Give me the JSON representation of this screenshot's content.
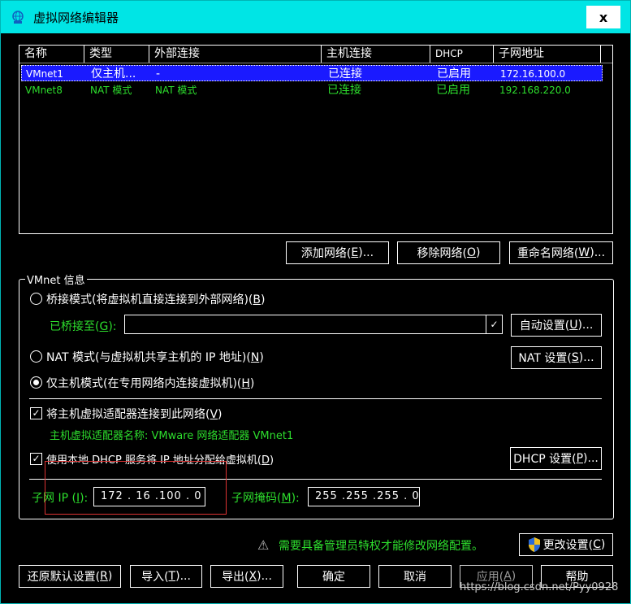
{
  "window": {
    "title": "虚拟网络编辑器",
    "close": "x"
  },
  "table": {
    "columns": [
      "名称",
      "类型",
      "外部连接",
      "主机连接",
      "DHCP",
      "子网地址"
    ],
    "rows": [
      {
        "name": "VMnet1",
        "type": "仅主机...",
        "external": "-",
        "host": "已连接",
        "dhcp": "已启用",
        "subnet": "172.16.100.0"
      },
      {
        "name": "VMnet8",
        "type": "NAT 模式",
        "external": "NAT 模式",
        "host": "已连接",
        "dhcp": "已启用",
        "subnet": "192.168.220.0"
      }
    ]
  },
  "net_buttons": {
    "add": {
      "label": "添加网络(",
      "key": "E",
      "tail": ")..."
    },
    "remove": {
      "label": "移除网络(",
      "key": "O",
      "tail": ")"
    },
    "rename": {
      "label": "重命名网络(",
      "key": "W",
      "tail": ")..."
    }
  },
  "info": {
    "title": "VMnet 信息",
    "bridge": {
      "label": "桥接模式(将虚拟机直接连接到外部网络)(",
      "key": "B",
      "tail": ")"
    },
    "bridged_to": {
      "label": "已桥接至(",
      "key": "G",
      "tail": "):"
    },
    "auto_btn": {
      "label": "自动设置(",
      "key": "U",
      "tail": ")..."
    },
    "nat": {
      "label": "NAT 模式(与虚拟机共享主机的 IP 地址)(",
      "key": "N",
      "tail": ")"
    },
    "nat_btn": {
      "label": "NAT 设置(",
      "key": "S",
      "tail": ")..."
    },
    "hostonly": {
      "label": "仅主机模式(在专用网络内连接虚拟机)(",
      "key": "H",
      "tail": ")"
    },
    "connect_adapter": {
      "label": "将主机虚拟适配器连接到此网络(",
      "key": "V",
      "tail": ")"
    },
    "adapter_name": "主机虚拟适配器名称: VMware 网络适配器 VMnet1",
    "use_dhcp": {
      "label": "使用本地 DHCP 服务将 IP 地址分配给虚拟机(",
      "key": "D",
      "tail": ")"
    },
    "dhcp_btn": {
      "label": "DHCP 设置(",
      "key": "P",
      "tail": ")..."
    },
    "subnet_ip": {
      "label": "子网 IP (",
      "key": "I",
      "tail": "):",
      "value": "172 . 16 .100 . 0"
    },
    "subnet_mask": {
      "label": "子网掩码(",
      "key": "M",
      "tail": "):",
      "value": "255 .255 .255 . 0"
    }
  },
  "admin": {
    "warning": "需要具备管理员特权才能修改网络配置。",
    "change_btn": {
      "label": "更改设置(",
      "key": "C",
      "tail": ")"
    }
  },
  "bottom": {
    "restore": {
      "label": "还原默认设置(",
      "key": "R",
      "tail": ")"
    },
    "import": {
      "label": "导入(",
      "key": "T",
      "tail": ")..."
    },
    "export": {
      "label": "导出(",
      "key": "X",
      "tail": ")..."
    },
    "ok": "确定",
    "cancel": "取消",
    "apply": {
      "label": "应用(",
      "key": "A",
      "tail": ")"
    },
    "help": "帮助"
  },
  "watermark": "https://blog.csdn.net/Pyy0928",
  "colors": {
    "titlebar": "#00e5e5",
    "selection": "#1a1aff",
    "green_text": "#2dde2d",
    "highlight_box": "#dd3333"
  }
}
